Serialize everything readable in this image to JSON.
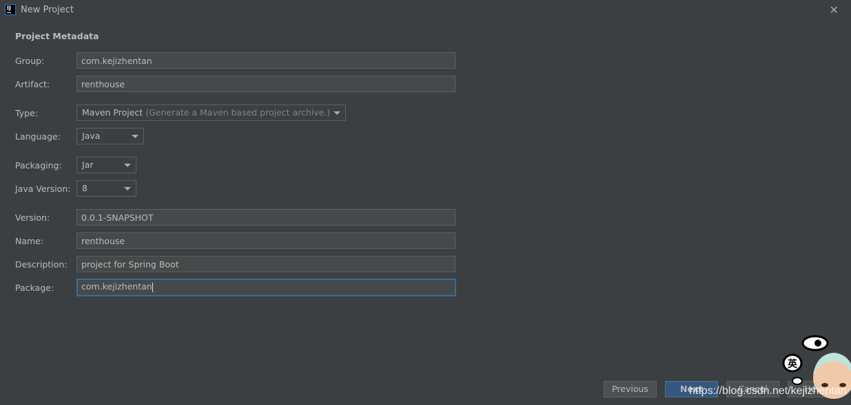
{
  "window": {
    "title": "New Project",
    "app_icon": "intellij-idea-icon",
    "close_icon": "close-icon"
  },
  "section_title": "Project Metadata",
  "fields": {
    "group": {
      "label": "Group:",
      "value": "com.kejizhentan"
    },
    "artifact": {
      "label": "Artifact:",
      "value": "renthouse"
    },
    "type": {
      "label": "Type:",
      "value": "Maven Project",
      "hint": "(Generate a Maven based project archive.)"
    },
    "language": {
      "label": "Language:",
      "value": "Java"
    },
    "packaging": {
      "label": "Packaging:",
      "value": "Jar"
    },
    "java_version": {
      "label": "Java Version:",
      "value": "8"
    },
    "version": {
      "label": "Version:",
      "value": "0.0.1-SNAPSHOT"
    },
    "name": {
      "label": "Name:",
      "value": "renthouse"
    },
    "description": {
      "label": "Description:",
      "value": "project for Spring Boot"
    },
    "package": {
      "label": "Package:",
      "value": "com.kejizhentan"
    }
  },
  "buttons": {
    "previous": "Previous",
    "next": "Next",
    "cancel": "Cancel",
    "help": "Help"
  },
  "watermark": "https://blog.csdn.net/kejizhentan",
  "colors": {
    "background": "#3c3f41",
    "primary_button": "#365880",
    "focus_border": "#3d6a94"
  }
}
